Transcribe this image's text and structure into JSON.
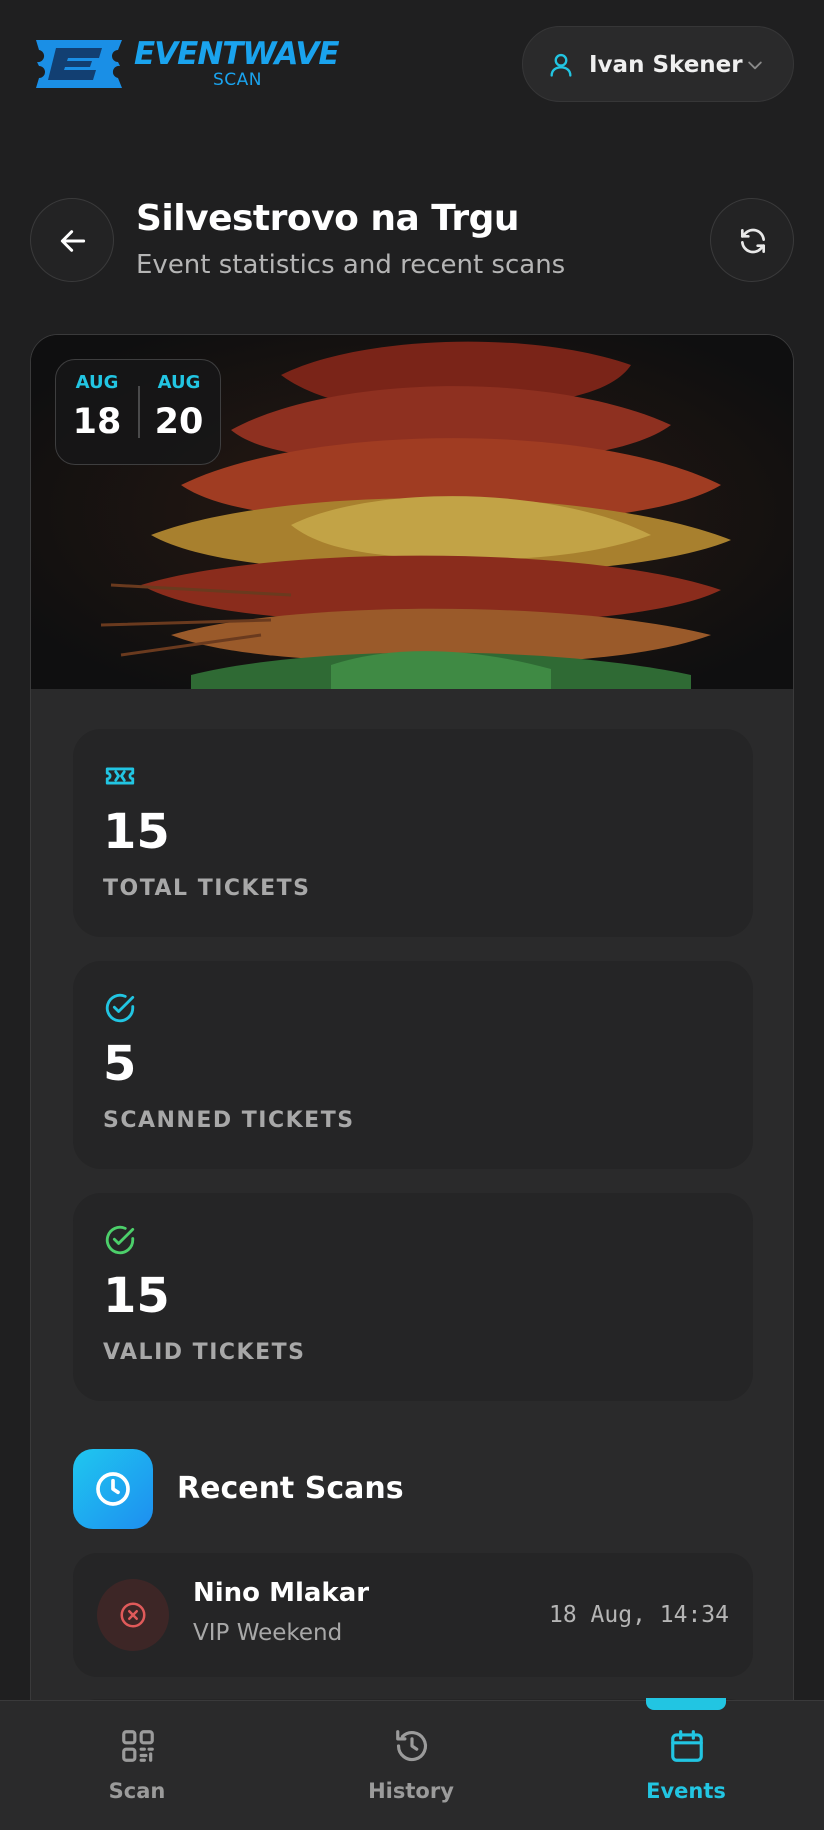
{
  "brand": {
    "name": "EVENTWAVE",
    "sub": "SCAN",
    "logo_icon": "ticket-e-logo",
    "color": "#1aa3ee"
  },
  "user": {
    "name": "Ivan Skener",
    "icon": "user-icon",
    "menu_icon": "chevron-down-icon"
  },
  "page": {
    "title": "Silvestrovo na Trgu",
    "subtitle": "Event statistics and recent scans",
    "back_icon": "arrow-left-icon",
    "refresh_icon": "refresh-icon"
  },
  "event": {
    "start": {
      "month": "AUG",
      "day": "18"
    },
    "end": {
      "month": "AUG",
      "day": "20"
    },
    "image": "autumn-leaves-photo"
  },
  "stats": [
    {
      "icon": "ticket-icon",
      "value": "15",
      "label": "TOTAL TICKETS",
      "color": "#22c5e2"
    },
    {
      "icon": "check-circle-icon",
      "value": "5",
      "label": "SCANNED TICKETS",
      "color": "#22c5e2"
    },
    {
      "icon": "check-circle-icon",
      "value": "15",
      "label": "VALID TICKETS",
      "color": "#4ccf6a"
    }
  ],
  "recent": {
    "title": "Recent Scans",
    "icon": "clock-icon",
    "items": [
      {
        "name": "Nino Mlakar",
        "ticket_type": "VIP Weekend",
        "time": "18 Aug, 14:34",
        "status": "invalid",
        "status_icon": "x-circle-icon"
      }
    ]
  },
  "nav": [
    {
      "label": "Scan",
      "icon": "qr-code-icon",
      "active": false
    },
    {
      "label": "History",
      "icon": "history-icon",
      "active": false
    },
    {
      "label": "Events",
      "icon": "calendar-icon",
      "active": true
    }
  ],
  "colors": {
    "accent": "#22c5e2",
    "background": "#1f1f20",
    "card": "#2a2a2b",
    "success": "#4ccf6a",
    "error": "#e05a5a"
  }
}
